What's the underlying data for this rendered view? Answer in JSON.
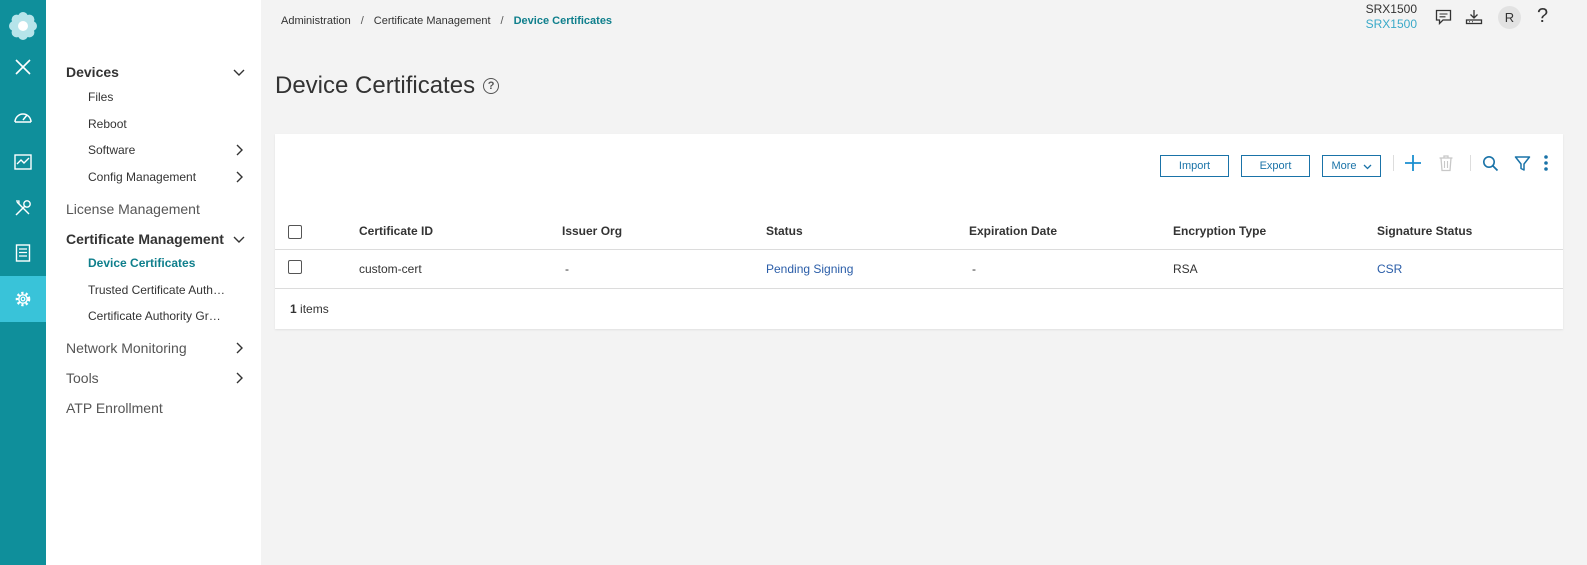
{
  "rail": {
    "items": [
      {
        "icon": "logo-icon"
      },
      {
        "icon": "close-icon"
      },
      {
        "icon": "dashboard-icon"
      },
      {
        "icon": "monitor-icon"
      },
      {
        "icon": "tools-icon"
      },
      {
        "icon": "reports-icon"
      },
      {
        "icon": "settings-icon",
        "active": true
      }
    ]
  },
  "sidebar": {
    "devices": "Devices",
    "files": "Files",
    "reboot": "Reboot",
    "software": "Software",
    "config_management": "Config Management",
    "license_management": "License Management",
    "certificate_management": "Certificate Management",
    "device_certificates": "Device Certificates",
    "trusted_ca": "Trusted Certificate Auth…",
    "ca_group": "Certificate Authority Gr…",
    "network_monitoring": "Network Monitoring",
    "tools": "Tools",
    "atp_enrollment": "ATP Enrollment"
  },
  "breadcrumb": {
    "items": [
      "Administration",
      "Certificate Management",
      "Device Certificates"
    ],
    "separator": "/"
  },
  "header": {
    "device_name": "SRX1500",
    "device_model": "SRX1500",
    "avatar_initial": "R",
    "help": "?"
  },
  "page": {
    "title": "Device Certificates",
    "help_glyph": "?"
  },
  "toolbar": {
    "import": "Import",
    "export": "Export",
    "more": "More"
  },
  "table": {
    "columns": [
      "Certificate ID",
      "Issuer Org",
      "Status",
      "Expiration Date",
      "Encryption Type",
      "Signature Status"
    ],
    "rows": [
      {
        "certificate_id": "custom-cert",
        "issuer_org": "-",
        "status": "Pending Signing",
        "expiration_date": "-",
        "encryption_type": "RSA",
        "signature_status": "CSR"
      }
    ],
    "footer_count": "1",
    "footer_label": " items"
  },
  "colors": {
    "rail": "#0f8f9b",
    "rail_active": "#39c3d9",
    "accent": "#0f7f8c",
    "link": "#2a5da8",
    "button": "#1a73a8"
  }
}
